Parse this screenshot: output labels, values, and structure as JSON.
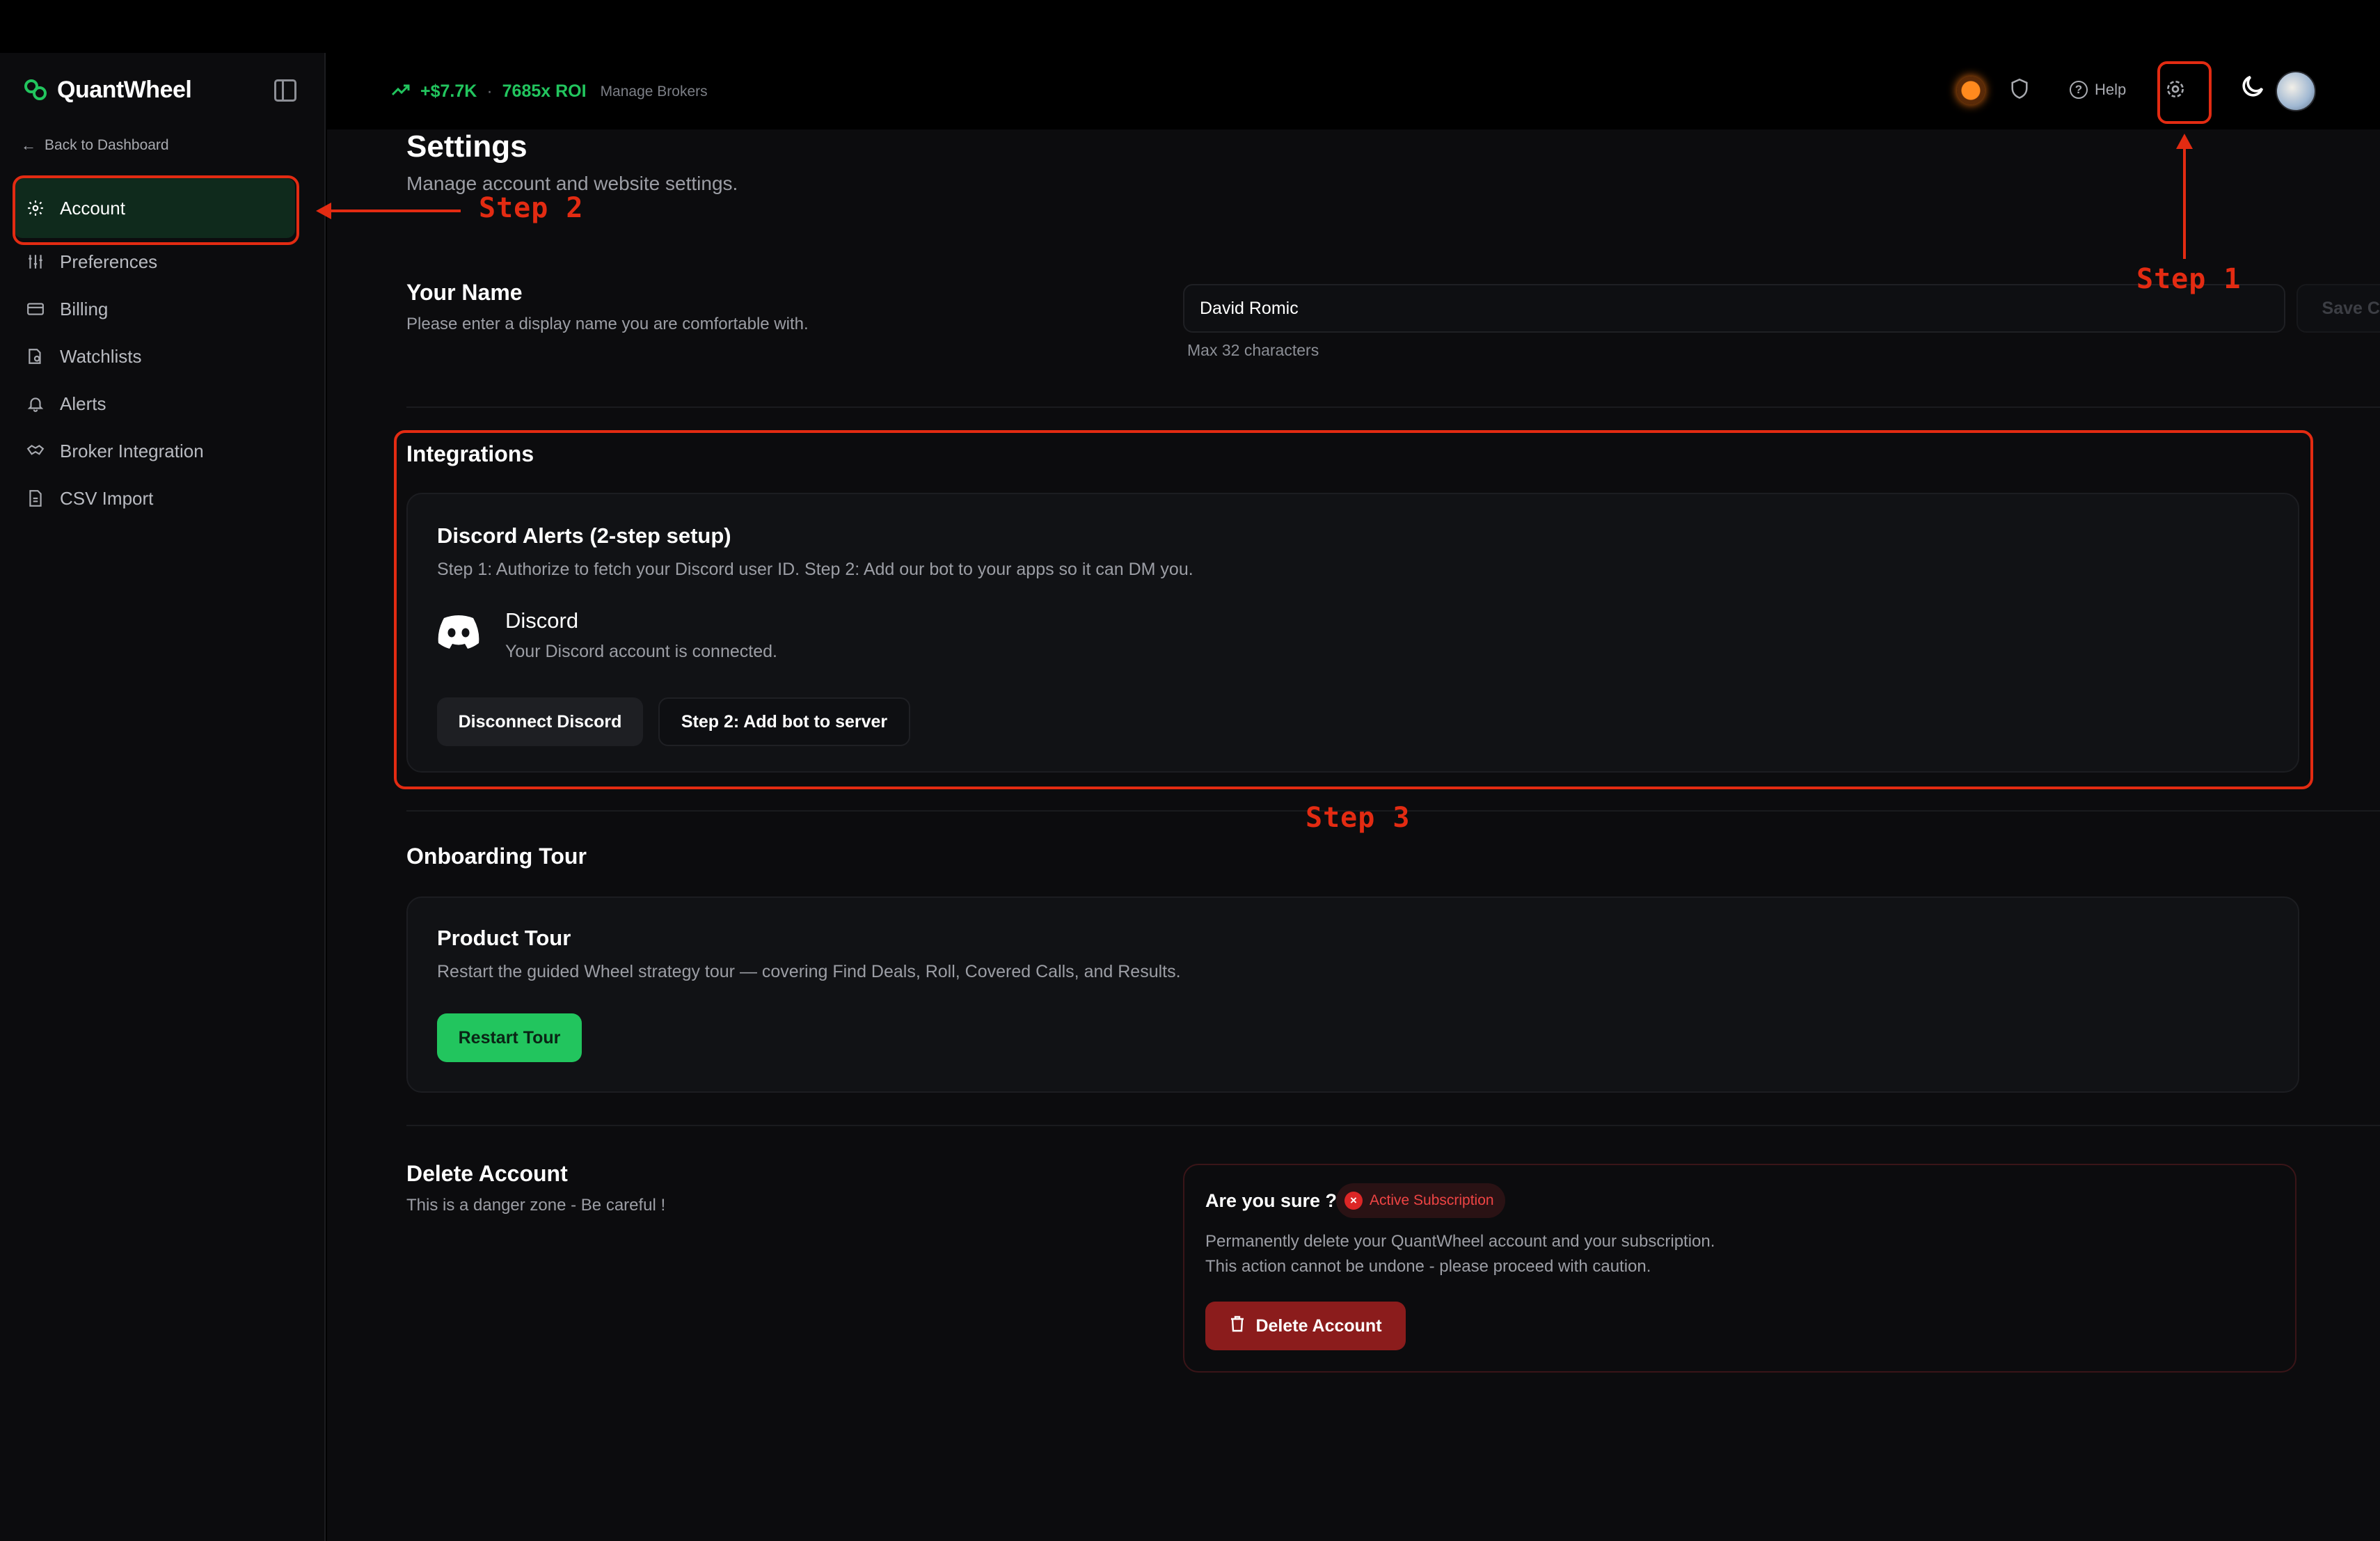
{
  "brand": {
    "name": "QuantWheel"
  },
  "sidebar": {
    "back_label": "Back to Dashboard",
    "items": [
      {
        "label": "Account",
        "icon": "gear-icon"
      },
      {
        "label": "Preferences",
        "icon": "sliders-icon"
      },
      {
        "label": "Billing",
        "icon": "credit-card-icon"
      },
      {
        "label": "Watchlists",
        "icon": "watchlist-icon"
      },
      {
        "label": "Alerts",
        "icon": "bell-icon"
      },
      {
        "label": "Broker Integration",
        "icon": "handshake-icon"
      },
      {
        "label": "CSV Import",
        "icon": "file-icon"
      }
    ]
  },
  "topbar": {
    "pnl_value": "+$7.7K",
    "separator": "·",
    "roi": "7685x ROI",
    "manage_brokers": "Manage Brokers",
    "help_label": "Help"
  },
  "page": {
    "title": "Settings",
    "subtitle": "Manage account and website settings."
  },
  "your_name": {
    "title": "Your Name",
    "description": "Please enter a display name you are comfortable with.",
    "value": "David Romic",
    "hint": "Max 32 characters",
    "save_label": "Save Changes"
  },
  "integrations": {
    "title": "Integrations",
    "card_title": "Discord Alerts (2-step setup)",
    "card_description": "Step 1: Authorize to fetch your Discord user ID. Step 2: Add our bot to your apps so it can DM you.",
    "service_name": "Discord",
    "service_status": "Your Discord account is connected.",
    "disconnect_label": "Disconnect Discord",
    "add_bot_label": "Step 2: Add bot to server"
  },
  "onboarding": {
    "title": "Onboarding Tour",
    "card_title": "Product Tour",
    "card_description": "Restart the guided Wheel strategy tour — covering Find Deals, Roll, Covered Calls, and Results.",
    "button_label": "Restart Tour"
  },
  "delete_account": {
    "title": "Delete Account",
    "description": "This is a danger zone - Be careful !",
    "confirm_question": "Are you sure ?",
    "badge_label": "Active Subscription",
    "warning_line1": "Permanently delete your QuantWheel account and your subscription.",
    "warning_line2": "This action cannot be undone - please proceed with caution.",
    "button_label": "Delete Account"
  },
  "annotations": {
    "step1": "Step 1",
    "step2": "Step 2",
    "step3": "Step 3",
    "color": "#e32b12"
  },
  "colors": {
    "accent_green": "#22c55e",
    "danger_red": "#8b1c1c",
    "background": "#0c0c0e"
  }
}
